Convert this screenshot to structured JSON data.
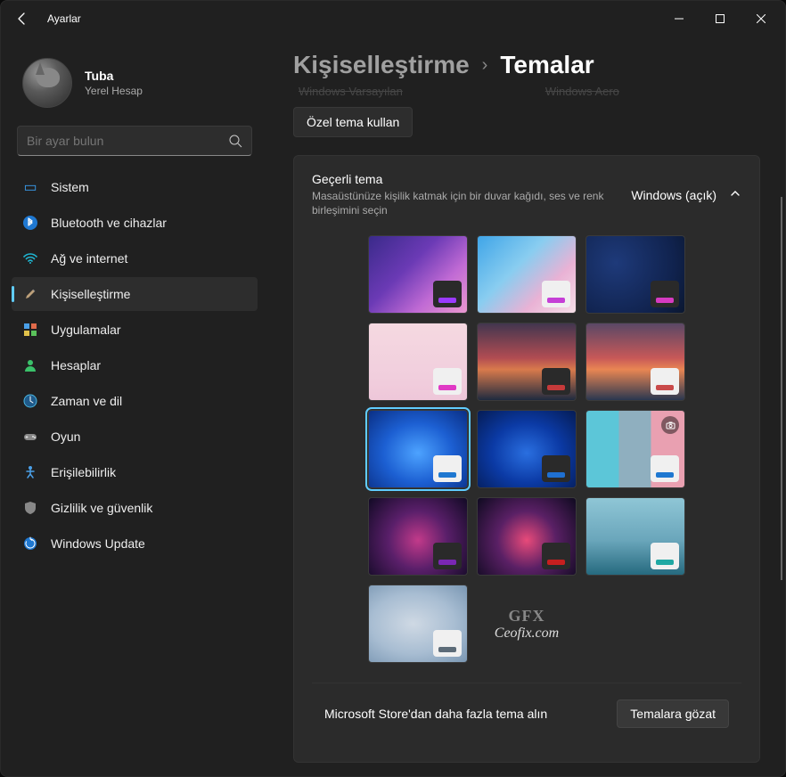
{
  "window": {
    "title": "Ayarlar"
  },
  "profile": {
    "name": "Tuba",
    "subtitle": "Yerel Hesap"
  },
  "search": {
    "placeholder": "Bir ayar bulun"
  },
  "nav": {
    "items": [
      {
        "label": "Sistem"
      },
      {
        "label": "Bluetooth ve cihazlar"
      },
      {
        "label": "Ağ ve internet"
      },
      {
        "label": "Kişiselleştirme"
      },
      {
        "label": "Uygulamalar"
      },
      {
        "label": "Hesaplar"
      },
      {
        "label": "Zaman ve dil"
      },
      {
        "label": "Oyun"
      },
      {
        "label": "Erişilebilirlik"
      },
      {
        "label": "Gizlilik ve güvenlik"
      },
      {
        "label": "Windows Update"
      }
    ]
  },
  "breadcrumb": {
    "parent": "Kişiselleştirme",
    "current": "Temalar"
  },
  "truncated": {
    "left": "Windows Varsayılan",
    "right": "Windows Aero"
  },
  "custom_theme_btn": "Özel tema kullan",
  "panel": {
    "title": "Geçerli tema",
    "subtitle": "Masaüstünüze kişilik katmak için bir duvar kağıdı, ses ve renk birleşimini seçin",
    "selected_label": "Windows (açık)"
  },
  "footer": {
    "more_text": "Microsoft Store'dan daha fazla tema alın",
    "browse_btn": "Temalara gözat"
  },
  "themes": [
    {
      "badge_bg": "dark",
      "accent": "#9a3aff",
      "selected": false
    },
    {
      "badge_bg": "light",
      "accent": "#c53fd6",
      "selected": false
    },
    {
      "badge_bg": "dark",
      "accent": "#d63bc1",
      "selected": false
    },
    {
      "badge_bg": "light",
      "accent": "#e03ac5",
      "selected": false
    },
    {
      "badge_bg": "dark",
      "accent": "#c63a3a",
      "selected": false
    },
    {
      "badge_bg": "light",
      "accent": "#c94a4a",
      "selected": false
    },
    {
      "badge_bg": "light",
      "accent": "#1f78d1",
      "selected": true
    },
    {
      "badge_bg": "dark",
      "accent": "#1f70d1",
      "selected": false
    },
    {
      "badge_bg": "light",
      "accent": "#1f78d1",
      "selected": false,
      "spotlight": true
    },
    {
      "badge_bg": "dark",
      "accent": "#7a27b3",
      "selected": false
    },
    {
      "badge_bg": "dark",
      "accent": "#c71f1f",
      "selected": false
    },
    {
      "badge_bg": "light",
      "accent": "#1fa8a3",
      "selected": false
    },
    {
      "badge_bg": "light",
      "accent": "#5c6b78",
      "selected": false
    }
  ],
  "watermark": {
    "top": "GFX",
    "bottom": "Ceofix.com"
  }
}
